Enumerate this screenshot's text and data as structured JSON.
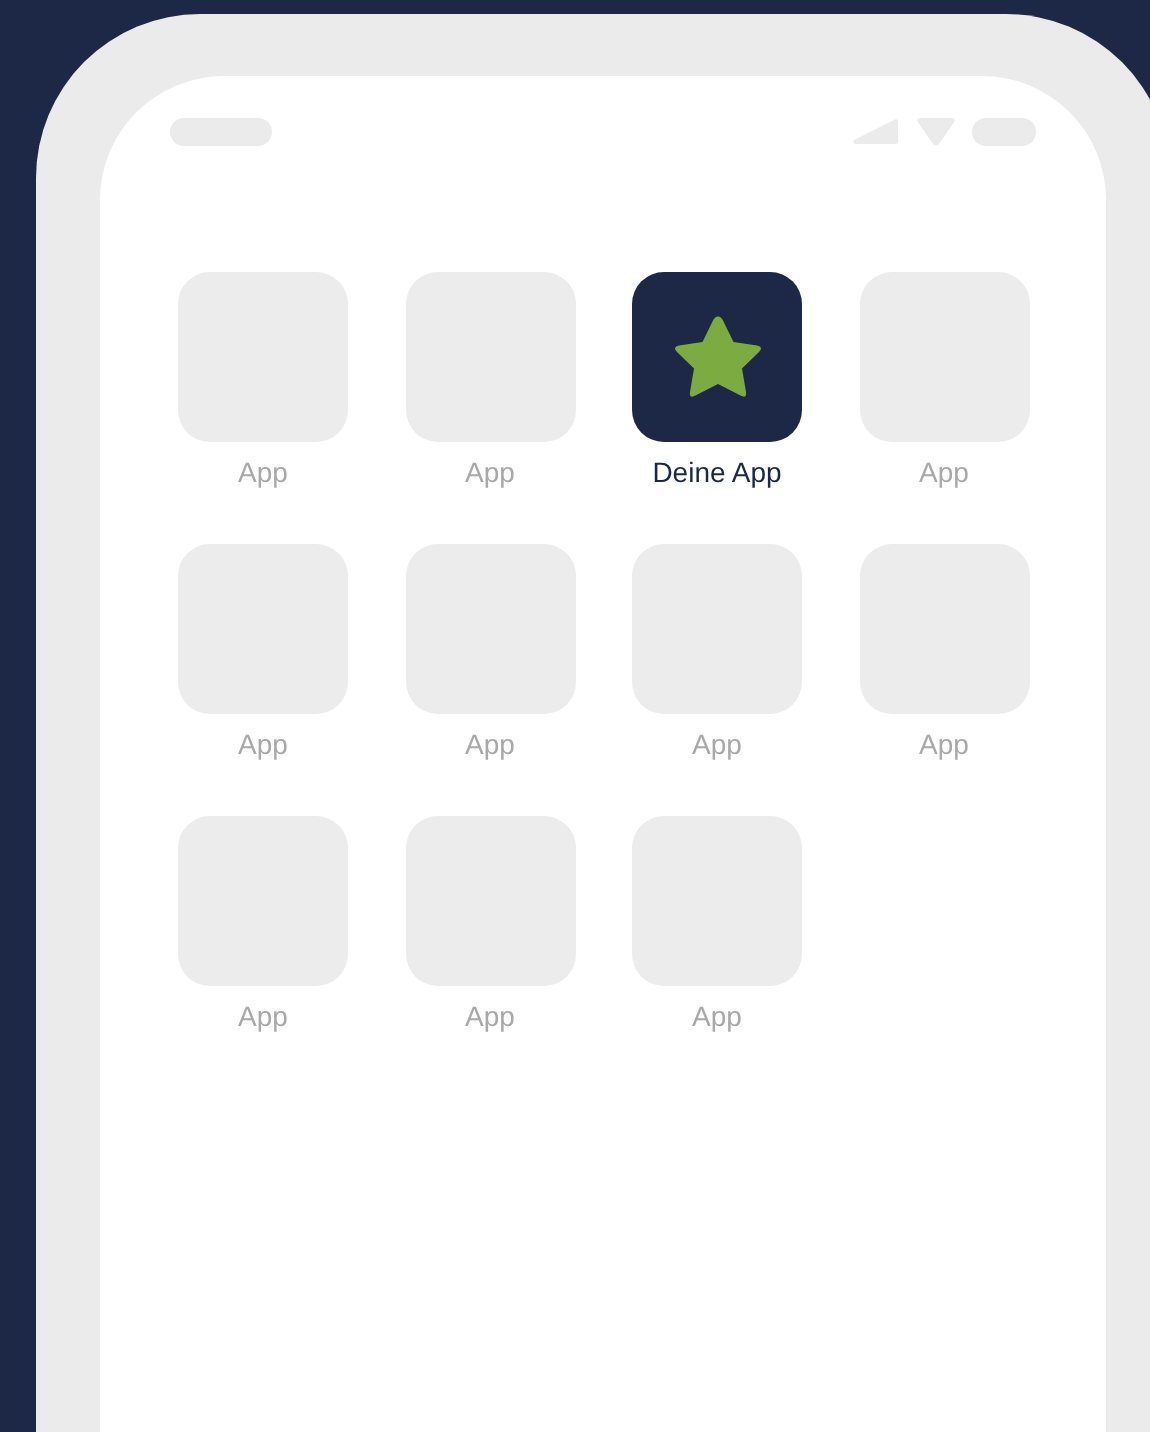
{
  "apps": [
    {
      "label": "App",
      "selected": false
    },
    {
      "label": "App",
      "selected": false
    },
    {
      "label": "Deine App",
      "selected": true
    },
    {
      "label": "App",
      "selected": false
    },
    {
      "label": "App",
      "selected": false
    },
    {
      "label": "App",
      "selected": false
    },
    {
      "label": "App",
      "selected": false
    },
    {
      "label": "App",
      "selected": false
    },
    {
      "label": "App",
      "selected": false
    },
    {
      "label": "App",
      "selected": false
    },
    {
      "label": "App",
      "selected": false
    }
  ]
}
